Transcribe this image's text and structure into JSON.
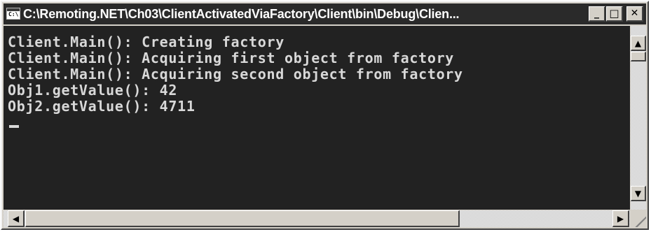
{
  "window": {
    "title": "C:\\Remoting.NET\\Ch03\\ClientActivatedViaFactory\\Client\\bin\\Debug\\Clien...",
    "icon_label": "C:\\"
  },
  "caption_buttons": {
    "minimize": "_",
    "maximize": "□",
    "close": "✕"
  },
  "console": {
    "lines": [
      "Client.Main(): Creating factory",
      "Client.Main(): Acquiring first object from factory",
      "Client.Main(): Acquiring second object from factory",
      "Obj1.getValue(): 42",
      "Obj2.getValue(): 4711"
    ]
  },
  "scrollbars": {
    "up_arrow": "▲",
    "down_arrow": "▼",
    "left_arrow": "◀",
    "right_arrow": "▶"
  },
  "colors": {
    "console_bg": "#222222",
    "console_text": "#d8d8d8",
    "titlebar_bg": "#2a2a2a",
    "chrome": "#d4d0c8"
  }
}
